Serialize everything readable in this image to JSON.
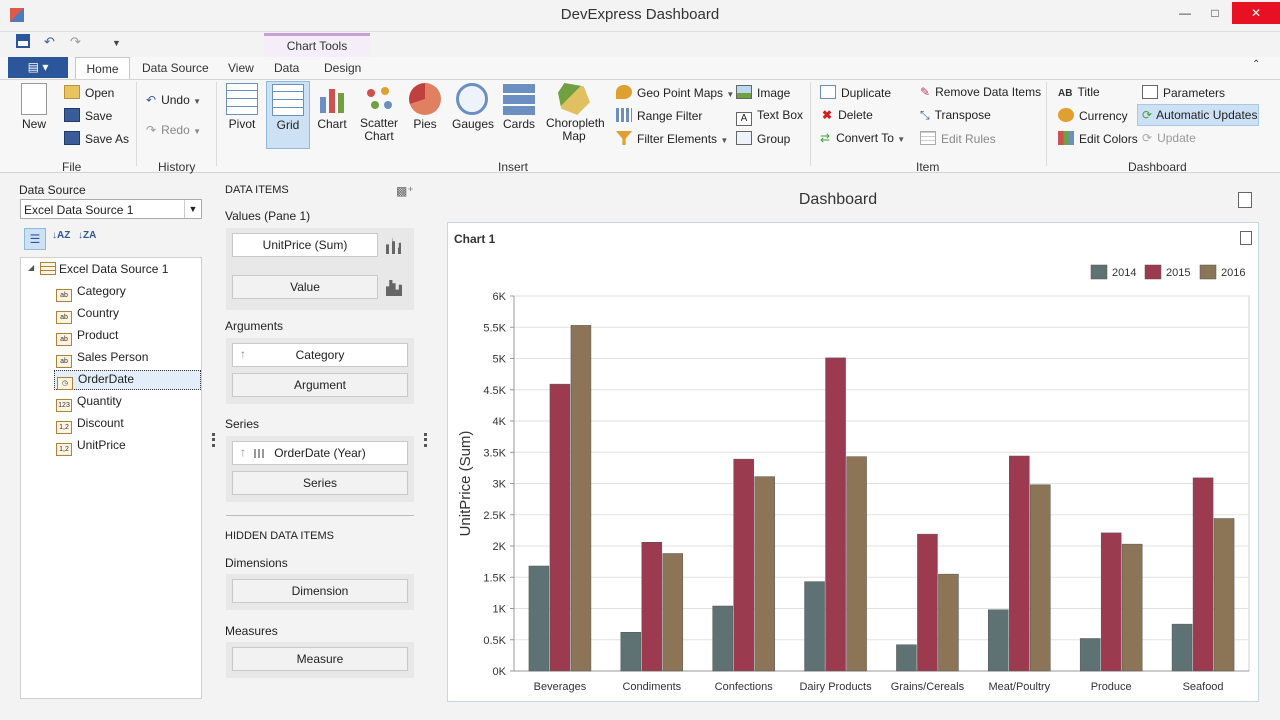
{
  "window": {
    "title": "DevExpress Dashboard"
  },
  "ribbon": {
    "context_tab": "Chart Tools",
    "tabs": [
      "Home",
      "Data Source",
      "View",
      "Data",
      "Design"
    ],
    "file": {
      "new": "New",
      "open": "Open",
      "save": "Save",
      "save_as": "Save As",
      "group": "File"
    },
    "history": {
      "undo": "Undo",
      "redo": "Redo",
      "group": "History"
    },
    "insert": {
      "pivot": "Pivot",
      "grid": "Grid",
      "chart": "Chart",
      "scatter": "Scatter Chart",
      "pies": "Pies",
      "gauges": "Gauges",
      "cards": "Cards",
      "choropleth": "Choropleth Map",
      "geo": "Geo Point Maps",
      "range": "Range Filter",
      "filter": "Filter Elements",
      "image": "Image",
      "textbox": "Text Box",
      "group_item": "Group",
      "group": "Insert"
    },
    "item": {
      "duplicate": "Duplicate",
      "delete": "Delete",
      "convert": "Convert To",
      "remove": "Remove Data Items",
      "transpose": "Transpose",
      "edit_rules": "Edit Rules",
      "group": "Item"
    },
    "dashboard": {
      "title": "Title",
      "currency": "Currency",
      "edit_colors": "Edit Colors",
      "parameters": "Parameters",
      "auto_updates": "Automatic Updates",
      "update": "Update",
      "group": "Dashboard"
    }
  },
  "datasource": {
    "label": "Data Source",
    "selected": "Excel Data Source 1",
    "root": "Excel Data Source 1",
    "fields": [
      {
        "name": "Category",
        "type": "ab"
      },
      {
        "name": "Country",
        "type": "ab"
      },
      {
        "name": "Product",
        "type": "ab"
      },
      {
        "name": "Sales Person",
        "type": "ab"
      },
      {
        "name": "OrderDate",
        "type": "date"
      },
      {
        "name": "Quantity",
        "type": "123"
      },
      {
        "name": "Discount",
        "type": "1,2"
      },
      {
        "name": "UnitPrice",
        "type": "1,2"
      }
    ]
  },
  "dataitems": {
    "title": "DATA ITEMS",
    "values_label": "Values (Pane 1)",
    "value1": "UnitPrice (Sum)",
    "value2": "Value",
    "arguments_label": "Arguments",
    "arg1": "Category",
    "arg2": "Argument",
    "series_label": "Series",
    "series1": "OrderDate (Year)",
    "series2": "Series",
    "hidden_title": "HIDDEN DATA ITEMS",
    "dimensions_label": "Dimensions",
    "dimension": "Dimension",
    "measures_label": "Measures",
    "measure": "Measure"
  },
  "dashboard": {
    "title": "Dashboard",
    "item_title": "Chart 1"
  },
  "colors": {
    "s2014": "#5e7173",
    "s2015": "#9c3b4f",
    "s2016": "#8c7456"
  },
  "chart_data": {
    "type": "bar",
    "categories": [
      "Beverages",
      "Condiments",
      "Confections",
      "Dairy Products",
      "Grains/Cereals",
      "Meat/Poultry",
      "Produce",
      "Seafood"
    ],
    "series": [
      {
        "name": "2014",
        "values": [
          1680,
          620,
          1040,
          1430,
          420,
          980,
          520,
          750
        ]
      },
      {
        "name": "2015",
        "values": [
          4590,
          2060,
          3390,
          5010,
          2190,
          3440,
          2210,
          3090
        ]
      },
      {
        "name": "2016",
        "values": [
          5530,
          1880,
          3110,
          3430,
          1550,
          2980,
          2030,
          2440
        ]
      }
    ],
    "ylabel": "UnitPrice (Sum)",
    "ylim": [
      0,
      6000
    ],
    "yticks": [
      "0K",
      "0.5K",
      "1K",
      "1.5K",
      "2K",
      "2.5K",
      "3K",
      "3.5K",
      "4K",
      "4.5K",
      "5K",
      "5.5K",
      "6K"
    ],
    "legend": "top-right",
    "grid": true
  }
}
